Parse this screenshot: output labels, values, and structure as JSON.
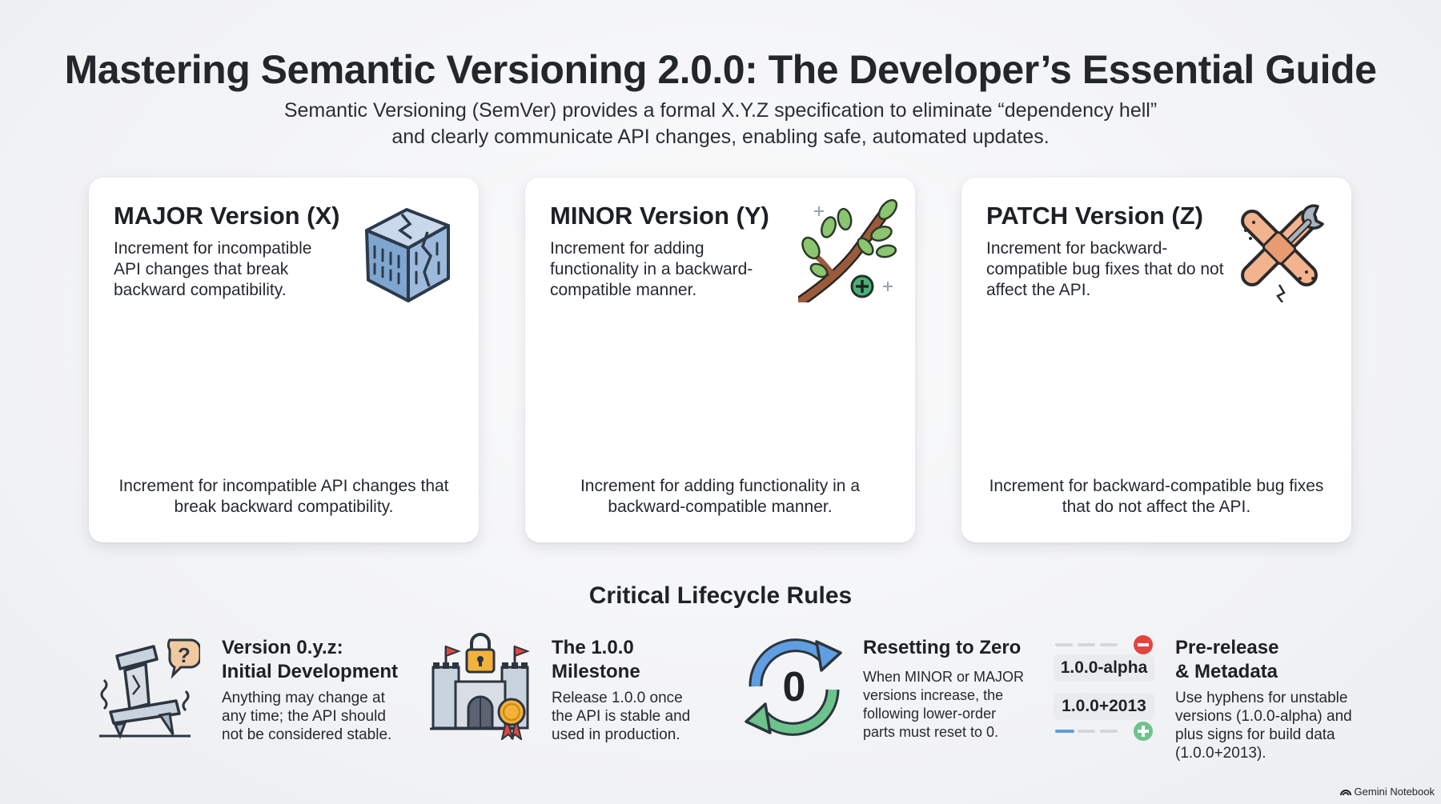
{
  "header": {
    "title": "Mastering Semantic Versioning 2.0.0: The Developer’s Essential Guide",
    "subtitle_line1": "Semantic Versioning (SemVer) provides a formal X.Y.Z specification to eliminate “dependency hell”",
    "subtitle_line2": "and clearly communicate API changes, enabling safe, automated updates."
  },
  "cards": [
    {
      "title": "MAJOR Version (X)",
      "description": "Increment for incompatible API changes that break backward compatibility.",
      "footer": "Increment for incompatible API changes that break backward compatibility.",
      "icon": "cracked-block-icon"
    },
    {
      "title": "MINOR Version (Y)",
      "description": "Increment for adding functionality in a backward-compatible manner.",
      "footer": "Increment for adding functionality in a backward-compatible manner.",
      "icon": "growing-branch-icon"
    },
    {
      "title": "PATCH Version (Z)",
      "description": "Increment for backward-compatible bug fixes that do not affect the API.",
      "footer": "Increment for backward-compatible bug fixes that do not affect the API.",
      "icon": "bandage-wrench-icon"
    }
  ],
  "lifecycle": {
    "title": "Critical Lifecycle Rules",
    "rules": [
      {
        "title_line1": "Version 0.y.z:",
        "title_line2": "Initial Development",
        "description": "Anything may change at any time; the API should not be considered stable.",
        "icon": "unstable-pillar-icon"
      },
      {
        "title_line1": "The 1.0.0",
        "title_line2": "Milestone",
        "description": "Release 1.0.0 once the API is stable and used in production.",
        "icon": "castle-lock-icon"
      },
      {
        "title_line1": "Resetting to Zero",
        "title_line2": "",
        "description": "When MINOR or MAJOR versions increase, the following lower-order parts must reset to 0.",
        "icon": "reset-cycle-icon",
        "icon_glyph": "0"
      },
      {
        "title_line1": "Pre-release",
        "title_line2": "& Metadata",
        "description": "Use hyphens for unstable versions (1.0.0-alpha) and plus signs for build data (1.0.0+2013).",
        "icon": "version-tags-icon",
        "tag1": "1.0.0-alpha",
        "tag2": "1.0.0+2013"
      }
    ]
  },
  "brand": {
    "label": "Gemini Notebook"
  },
  "colors": {
    "accent_green": "#4caf7a",
    "accent_red": "#e0463f",
    "accent_blue": "#4d8fd6",
    "bandage": "#f3b38e"
  }
}
